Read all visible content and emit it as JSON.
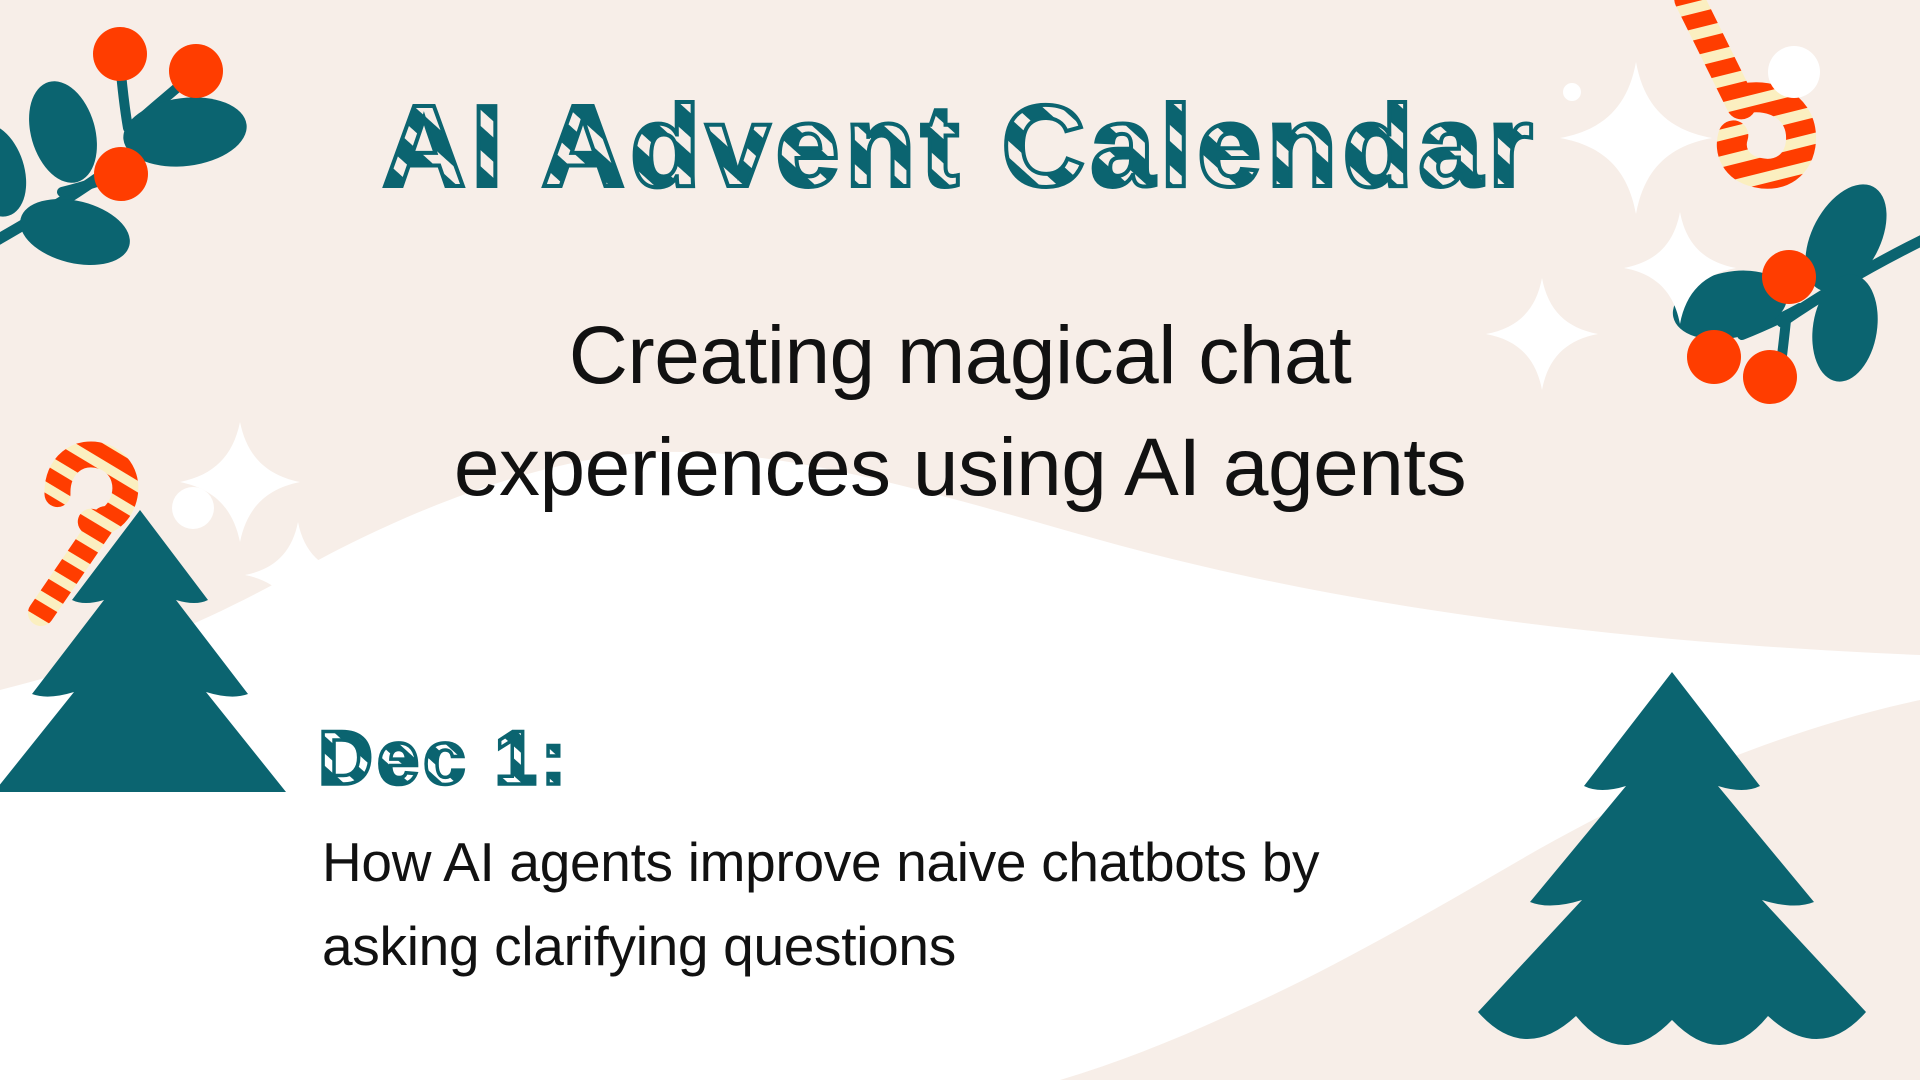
{
  "banner": {
    "title": "AI Advent Calendar",
    "subtitle_lines": [
      "Creating magical chat",
      "experiences using AI agents"
    ],
    "date_label": "Dec 1:",
    "body_lines": [
      "How AI agents improve naive chatbots by",
      "asking clarifying questions"
    ]
  },
  "colors": {
    "background_cream": "#F7EEE8",
    "wave_white": "#FFFFFF",
    "teal": "#0B6470",
    "berry_orange": "#FF3D00",
    "candy_stripe_cream": "#FBEFC0",
    "text_black": "#111111",
    "sparkle_white": "#FFFFFF"
  },
  "decorations": [
    {
      "name": "holly-branch-top-left",
      "berries": 3,
      "leaves": 4
    },
    {
      "name": "candy-cane-top-right",
      "stripes": "diagonal"
    },
    {
      "name": "holly-branch-top-right",
      "berries": 3,
      "leaves": 4
    },
    {
      "name": "candy-cane-left",
      "stripes": "diagonal"
    },
    {
      "name": "fir-tree-left",
      "tiers": 3
    },
    {
      "name": "fir-tree-right",
      "tiers": 3
    },
    {
      "name": "sparkle-star",
      "count": 5
    },
    {
      "name": "snow-dot",
      "count": 3
    }
  ]
}
